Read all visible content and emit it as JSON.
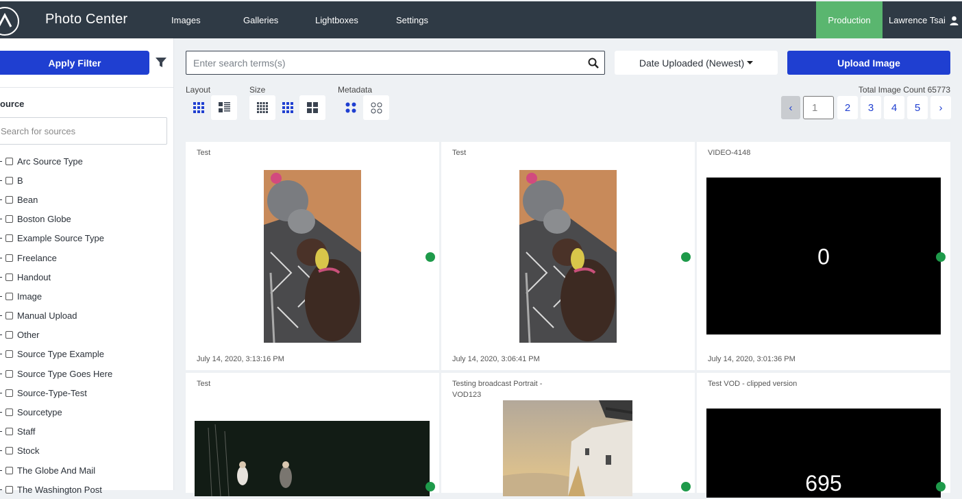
{
  "header": {
    "app_title": "Photo Center",
    "nav": [
      "Images",
      "Galleries",
      "Lightboxes",
      "Settings"
    ],
    "environment": "Production",
    "user_name": "Lawrence Tsai"
  },
  "sidebar": {
    "apply_filter_label": "Apply Filter",
    "source_heading": "ource",
    "source_search_placeholder": "Search for sources",
    "sources": [
      "Arc Source Type",
      "B",
      "Bean",
      "Boston Globe",
      "Example Source Type",
      "Freelance",
      "Handout",
      "Image",
      "Manual Upload",
      "Other",
      "Source Type Example",
      "Source Type Goes Here",
      "Source-Type-Test",
      "Sourcetype",
      "Staff",
      "Stock",
      "The Globe And Mail",
      "The Washington Post"
    ]
  },
  "toolbar": {
    "search_placeholder": "Enter search terms(s)",
    "sort_label": "Date Uploaded (Newest)",
    "upload_label": "Upload Image",
    "layout_label": "Layout",
    "size_label": "Size",
    "metadata_label": "Metadata",
    "total_count_label": "Total Image Count 65773"
  },
  "pagination": {
    "prev": "‹",
    "current": "1",
    "pages": [
      "2",
      "3",
      "4",
      "5"
    ],
    "next": "›"
  },
  "cards": [
    {
      "title": "Test",
      "date": "July 14, 2020, 3:13:16 PM",
      "kind": "dogs"
    },
    {
      "title": "Test",
      "date": "July 14, 2020, 3:06:41 PM",
      "kind": "dogs"
    },
    {
      "title": "VIDEO-4148",
      "date": "July 14, 2020, 3:01:36 PM",
      "kind": "video",
      "overlay": "0"
    },
    {
      "title": "Test",
      "date": "",
      "kind": "stage"
    },
    {
      "title": "Testing broadcast Portrait - VOD123",
      "date": "",
      "kind": "santorini"
    },
    {
      "title": "Test VOD - clipped version",
      "date": "",
      "kind": "video",
      "overlay": "695"
    }
  ],
  "colors": {
    "topbar": "#2f3a45",
    "primary": "#1f3fd1",
    "production": "#5ab66f",
    "status_dot": "#1e9a4a"
  }
}
